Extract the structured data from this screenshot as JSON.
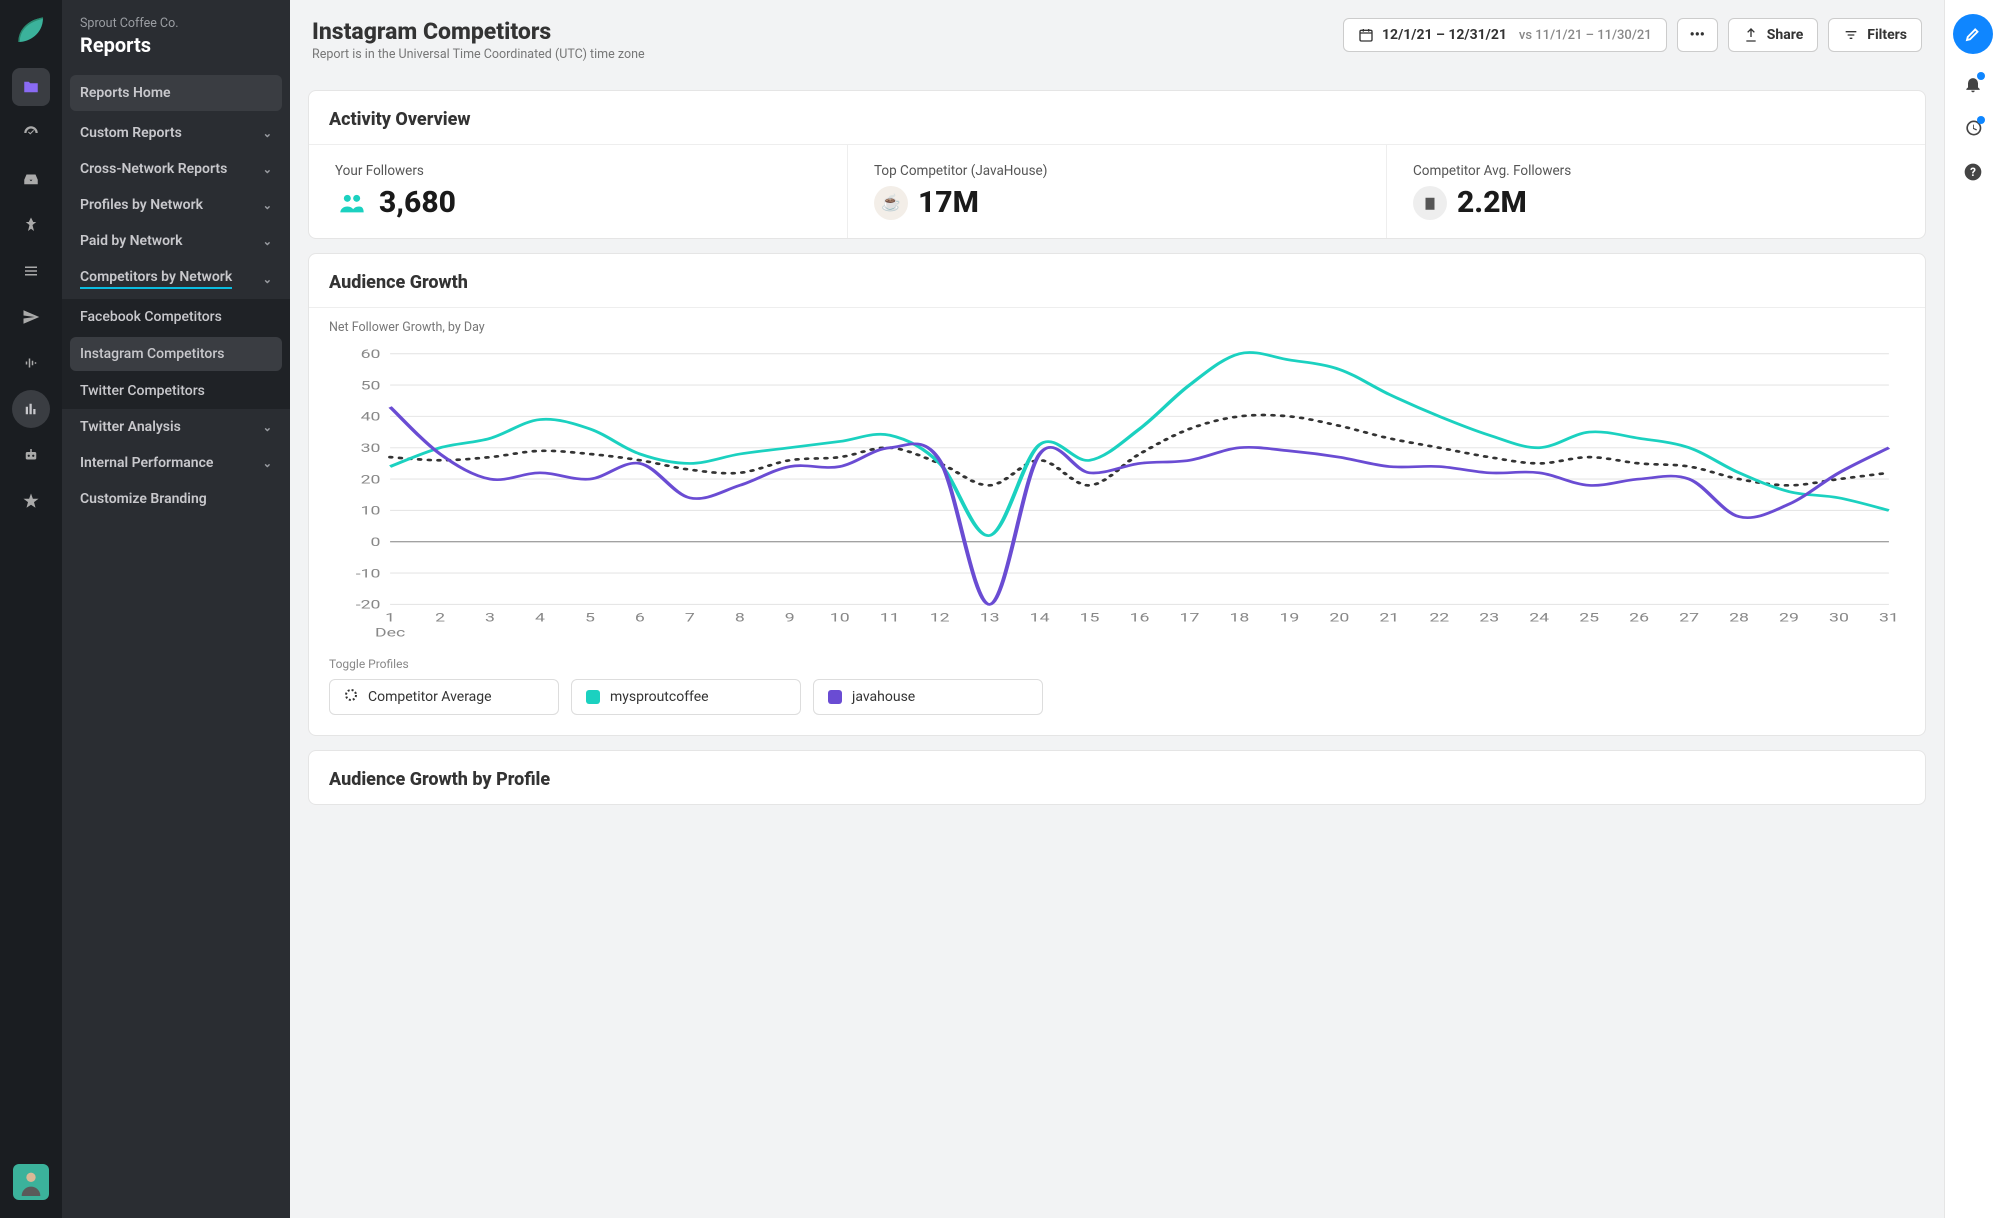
{
  "company": "Sprout Coffee Co.",
  "module": "Reports",
  "nav": {
    "home": "Reports Home",
    "custom": "Custom Reports",
    "cross": "Cross-Network Reports",
    "profiles": "Profiles by Network",
    "paid": "Paid by Network",
    "competitors": "Competitors by Network",
    "sub": {
      "fb": "Facebook Competitors",
      "ig": "Instagram Competitors",
      "tw": "Twitter Competitors"
    },
    "twitter_analysis": "Twitter Analysis",
    "internal": "Internal Performance",
    "branding": "Customize Branding"
  },
  "header": {
    "title": "Instagram Competitors",
    "subtitle": "Report is in the Universal Time Coordinated (UTC) time zone",
    "date_primary": "12/1/21 – 12/31/21",
    "date_compare": "vs 11/1/21 – 11/30/21",
    "share": "Share",
    "filters": "Filters"
  },
  "overview": {
    "title": "Activity Overview",
    "stats": [
      {
        "label": "Your Followers",
        "value": "3,680"
      },
      {
        "label": "Top Competitor (JavaHouse)",
        "value": "17M"
      },
      {
        "label": "Competitor Avg. Followers",
        "value": "2.2M"
      }
    ]
  },
  "growth": {
    "title": "Audience Growth",
    "subtitle": "Net Follower Growth, by Day",
    "toggle_label": "Toggle Profiles",
    "legend": [
      {
        "label": "Competitor Average",
        "color": "dotted"
      },
      {
        "label": "mysproutcoffee",
        "color": "#1bd1c0"
      },
      {
        "label": "javahouse",
        "color": "#6a4cd3"
      }
    ]
  },
  "growth_by_profile": {
    "title": "Audience Growth by Profile"
  },
  "chart_data": {
    "type": "line",
    "xlabel": "Dec",
    "ylabel": "",
    "ylim": [
      -20,
      60
    ],
    "x": [
      1,
      2,
      3,
      4,
      5,
      6,
      7,
      8,
      9,
      10,
      11,
      12,
      13,
      14,
      15,
      16,
      17,
      18,
      19,
      20,
      21,
      22,
      23,
      24,
      25,
      26,
      27,
      28,
      29,
      30,
      31
    ],
    "series": [
      {
        "name": "Competitor Average",
        "style": "dotted",
        "color": "#333",
        "values": [
          27,
          26,
          27,
          29,
          28,
          26,
          23,
          22,
          26,
          27,
          30,
          25,
          18,
          26,
          18,
          28,
          36,
          40,
          40,
          37,
          33,
          30,
          27,
          25,
          27,
          25,
          24,
          20,
          18,
          20,
          22
        ]
      },
      {
        "name": "mysproutcoffee",
        "color": "#1bd1c0",
        "values": [
          24,
          30,
          33,
          39,
          36,
          28,
          25,
          28,
          30,
          32,
          34,
          25,
          2,
          31,
          26,
          36,
          50,
          60,
          58,
          55,
          47,
          40,
          34,
          30,
          35,
          33,
          30,
          22,
          16,
          14,
          10
        ]
      },
      {
        "name": "javahouse",
        "color": "#6a4cd3",
        "values": [
          43,
          28,
          20,
          22,
          20,
          25,
          14,
          18,
          24,
          24,
          30,
          26,
          -20,
          28,
          22,
          25,
          26,
          30,
          29,
          27,
          24,
          24,
          22,
          22,
          18,
          20,
          20,
          8,
          12,
          22,
          30
        ]
      }
    ],
    "month_label": "Dec"
  }
}
